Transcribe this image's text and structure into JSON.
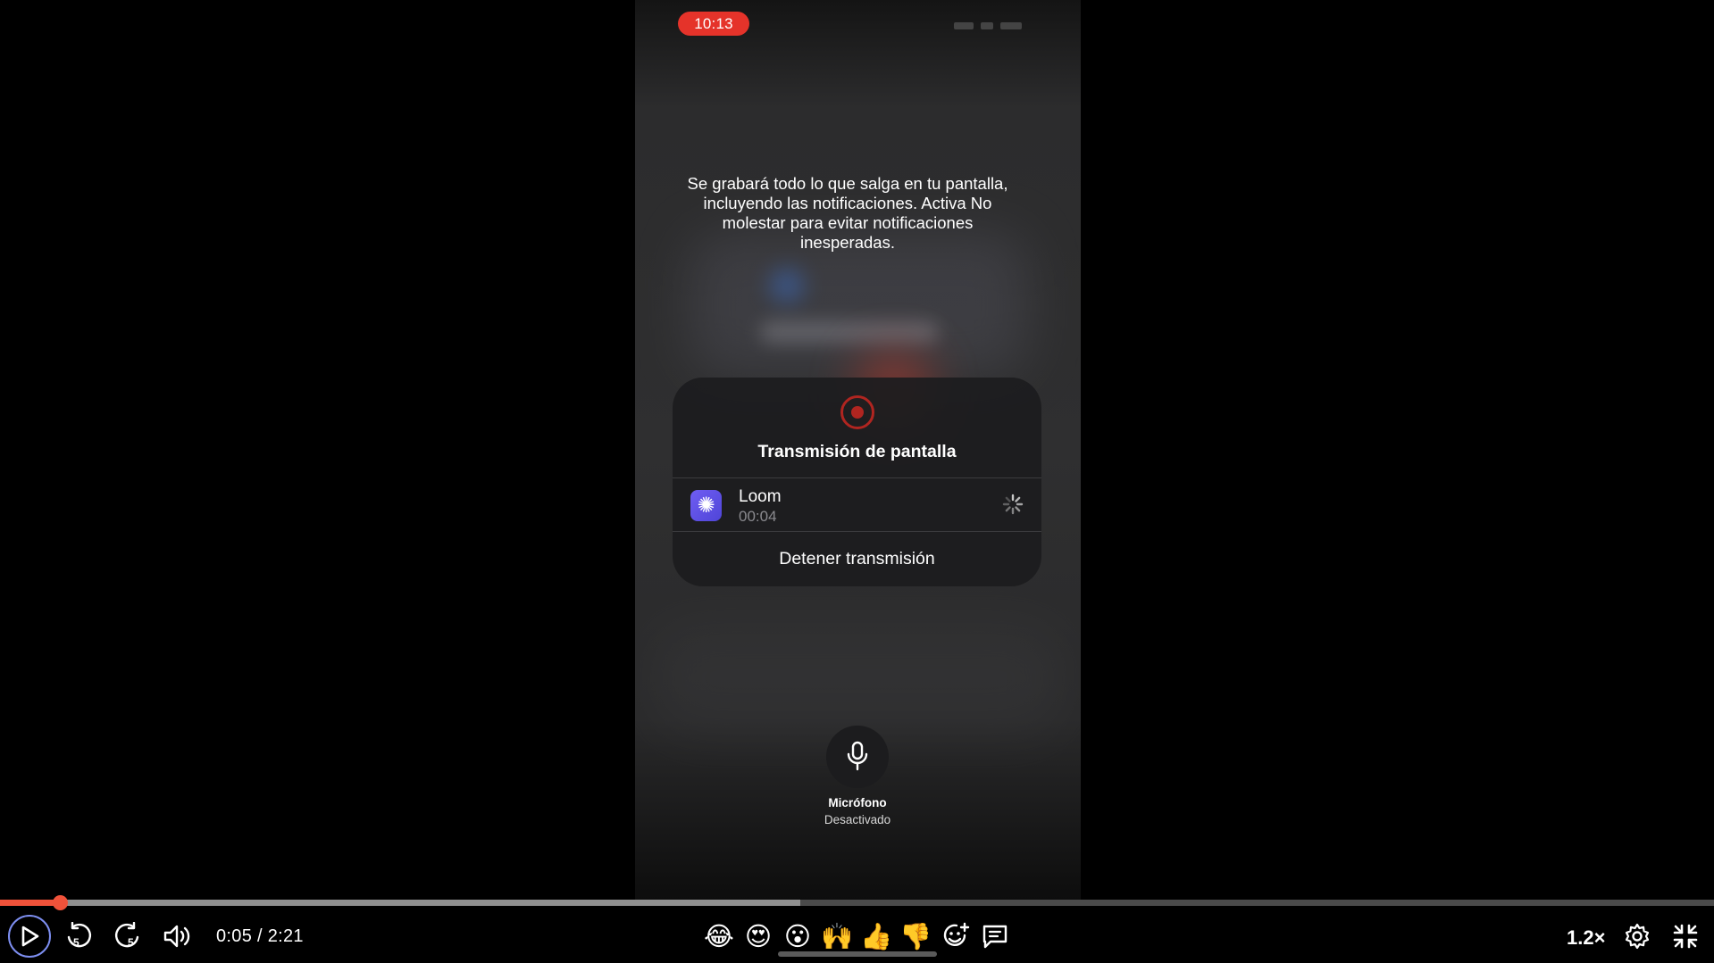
{
  "phone": {
    "status_time": "10:13",
    "warning": "Se grabará todo lo que salga en tu pantalla, incluyendo las notificaciones. Activa No molestar para evitar notificaciones inesperadas.",
    "broadcast": {
      "title": "Transmisión de pantalla",
      "app_name": "Loom",
      "app_time": "00:04",
      "stop_label": "Detener transmisión",
      "accent_color": "#b02520"
    },
    "microphone": {
      "label": "Micrófono",
      "state": "Desactivado"
    }
  },
  "player": {
    "current_time": "0:05",
    "duration": "2:21",
    "time_display": "0:05 / 2:21",
    "played_fraction": 0.035,
    "buffered_fraction": 0.467,
    "speed": "1.2×",
    "progress_color": "#f0523a",
    "reactions": [
      {
        "name": "joy-reaction",
        "glyph": "😂"
      },
      {
        "name": "heart-eyes-reaction",
        "glyph": "😍"
      },
      {
        "name": "surprised-reaction",
        "glyph": "😮"
      },
      {
        "name": "raised-hands-reaction",
        "glyph": "🙌"
      },
      {
        "name": "thumbs-up-reaction",
        "glyph": "👍"
      },
      {
        "name": "thumbs-down-reaction",
        "glyph": "👎"
      }
    ],
    "icons": [
      "play-icon",
      "rewind-5-icon",
      "forward-5-icon",
      "volume-icon",
      "add-reaction-icon",
      "comment-icon",
      "settings-icon",
      "exit-fullscreen-icon"
    ]
  }
}
